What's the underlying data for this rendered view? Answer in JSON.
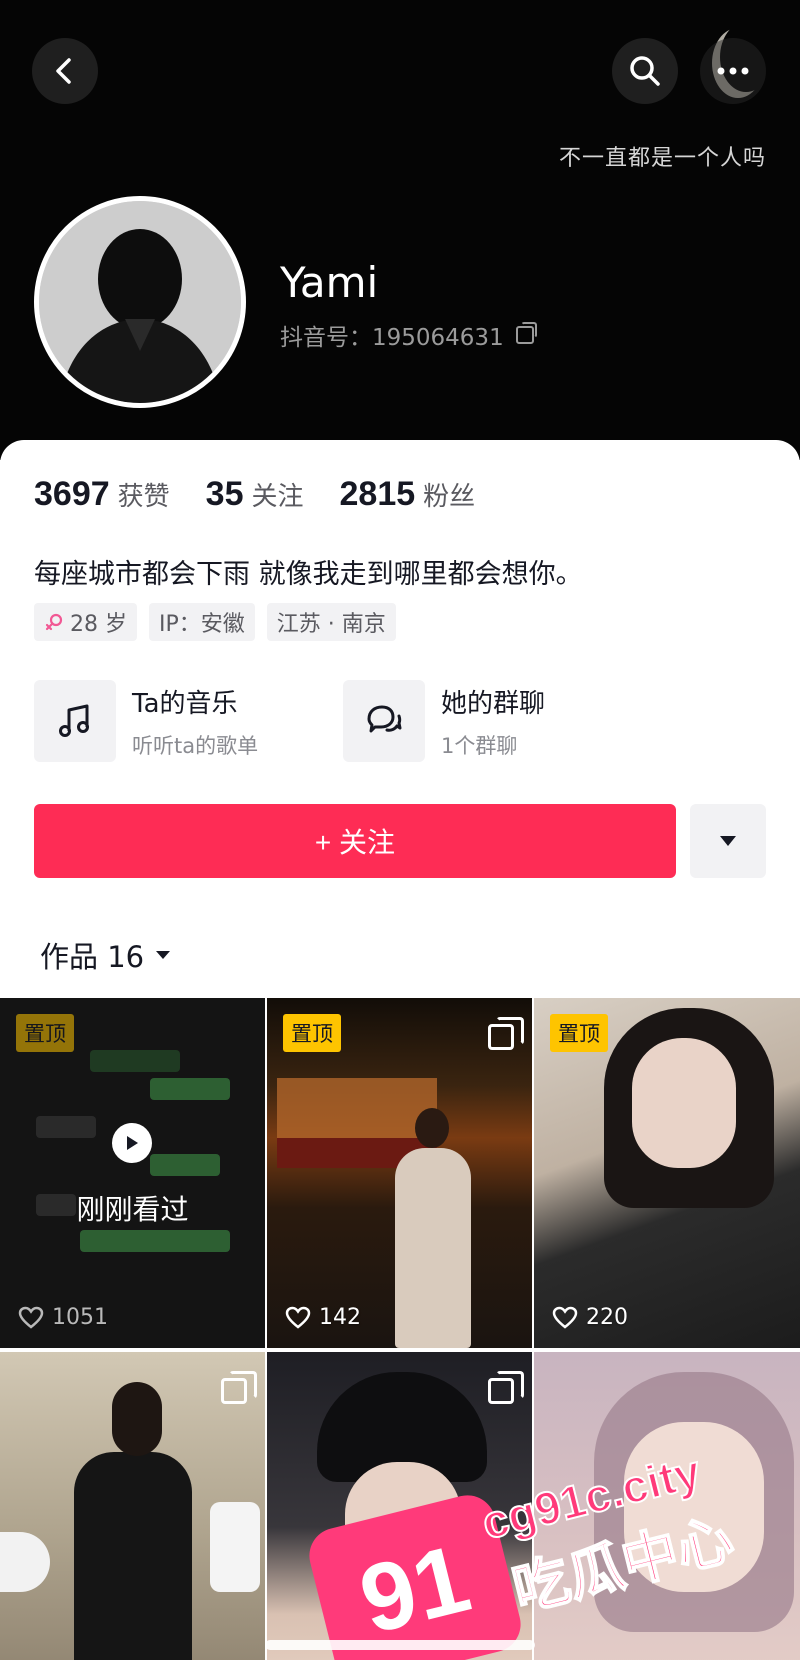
{
  "header": {
    "signature": "不一直都是一个人吗",
    "username": "Yami",
    "douyin_id": "抖音号：195064631"
  },
  "stats": [
    {
      "value": "3697",
      "label": "获赞"
    },
    {
      "value": "35",
      "label": "关注"
    },
    {
      "value": "2815",
      "label": "粉丝"
    }
  ],
  "bio": "每座城市都会下雨 就像我走到哪里都会想你。",
  "tags": {
    "age": "28 岁",
    "ip": "IP：安徽",
    "location": "江苏 · 南京"
  },
  "features": {
    "music": {
      "title": "Ta的音乐",
      "subtitle": "听听ta的歌单"
    },
    "group": {
      "title": "她的群聊",
      "subtitle": "1个群聊"
    }
  },
  "follow_label": "+ 关注",
  "works_tab": "作品 16",
  "grid": {
    "pin_label": "置顶",
    "viewed_label": "刚刚看过",
    "items": [
      {
        "likes": "1051"
      },
      {
        "likes": "142"
      },
      {
        "likes": "220"
      }
    ]
  },
  "watermark": {
    "badge": "91",
    "domain": "cg91c.city",
    "text": "吃瓜中心"
  },
  "colors": {
    "accent": "#fe2c55",
    "pin": "#fec400",
    "header_bg": "#050505"
  }
}
